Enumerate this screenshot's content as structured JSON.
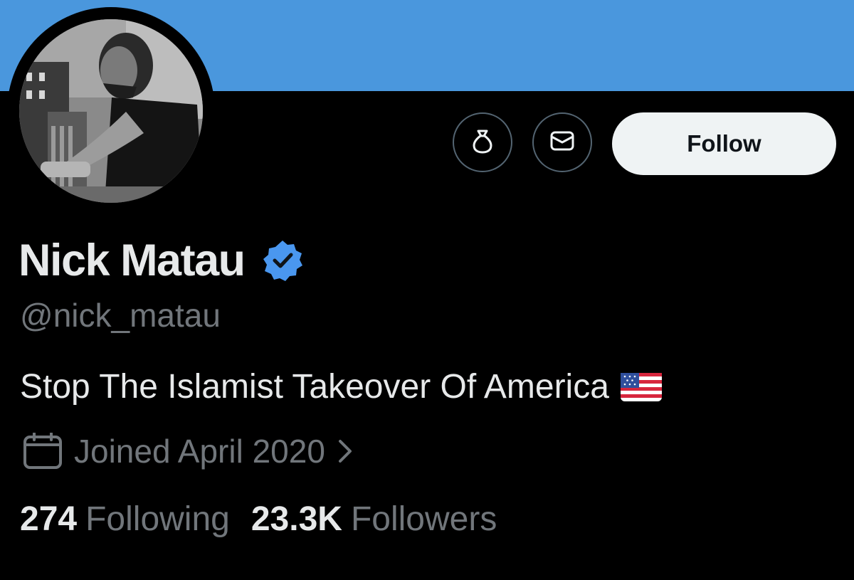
{
  "banner": {
    "color": "#4a97dd"
  },
  "profile": {
    "display_name": "Nick Matau",
    "handle": "@nick_matau",
    "bio": "Stop The Islamist Takeover Of America",
    "bio_emoji": "us-flag-icon",
    "joined": "Joined April 2020",
    "verified": true
  },
  "actions": {
    "tip_icon": "money-bag-icon",
    "message_icon": "envelope-icon",
    "follow_label": "Follow"
  },
  "stats": {
    "following_count": "274",
    "following_label": "Following",
    "followers_count": "23.3K",
    "followers_label": "Followers"
  },
  "colors": {
    "background": "#000000",
    "accent_verified": "#4a97ef",
    "muted_text": "#71767b",
    "primary_text": "#e7e9ea",
    "follow_button_bg": "#eff3f4"
  }
}
